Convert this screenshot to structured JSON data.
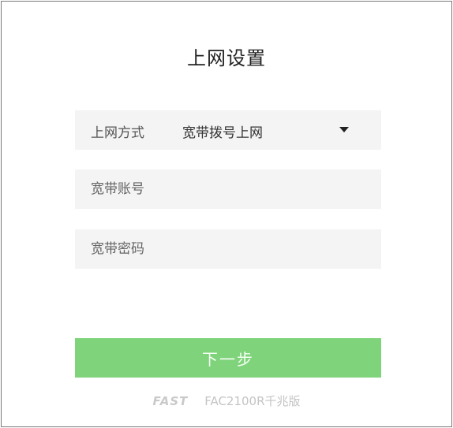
{
  "page": {
    "title": "上网设置"
  },
  "connection_mode": {
    "label": "上网方式",
    "selected": "宽带拨号上网"
  },
  "account": {
    "placeholder": "宽带账号",
    "value": ""
  },
  "password": {
    "placeholder": "宽带密码",
    "value": ""
  },
  "actions": {
    "next_label": "下一步"
  },
  "footer": {
    "brand": "FAST",
    "model": "FAC2100R千兆版"
  },
  "colors": {
    "accent": "#7fd37b",
    "field_bg": "#f4f4f4"
  }
}
